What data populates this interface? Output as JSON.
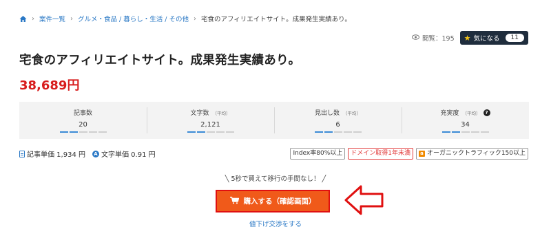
{
  "breadcrumb": {
    "home_icon": "home-icon",
    "items": [
      "案件一覧",
      "グルメ・食品 / 暮らし・生活 / その他"
    ],
    "current": "宅食のアフィリエイトサイト。成果発生実績あり。"
  },
  "meta": {
    "views_label": "閲覧：195",
    "favorite_label": "気になる",
    "favorite_count": "11"
  },
  "title": "宅食のアフィリエイトサイト。成果発生実績あり。",
  "price": "38,689円",
  "stats": [
    {
      "label": "記事数",
      "sub": "",
      "value": "20",
      "level": 0.4
    },
    {
      "label": "文字数",
      "sub": "（平均）",
      "value": "2,121",
      "level": 0.4
    },
    {
      "label": "見出し数",
      "sub": "（平均）",
      "value": "6",
      "level": 0.4
    },
    {
      "label": "充実度",
      "sub": "（平均）",
      "value": "34",
      "level": 0.4
    }
  ],
  "units": {
    "article_price": "記事単価 1,934 円",
    "char_price": "文字単価 0.91 円"
  },
  "tags": [
    {
      "label": "Index率80%以上",
      "style": "gray"
    },
    {
      "label": "ドメイン取得1年未満",
      "style": "red"
    },
    {
      "label": "オーガニックトラフィック150以上",
      "style": "amazon"
    }
  ],
  "promo": "╲ 5秒で買えて移行の手間なし！ ╱",
  "buy_button": "購入する（確認画面）",
  "negotiate_link": "値下げ交渉をする",
  "colors": {
    "accent": "#2a78c5",
    "price": "#d81e1e",
    "buy": "#f05a1a",
    "buy_border": "#e01010",
    "favorite_bg": "#1f2d3d"
  }
}
